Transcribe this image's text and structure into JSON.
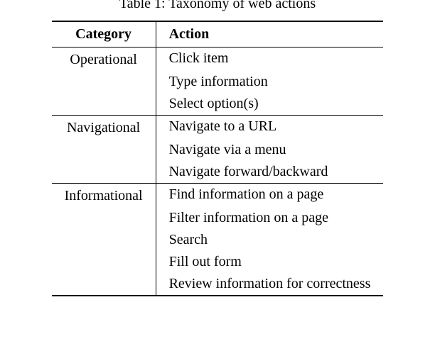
{
  "caption": "Table 1: Taxonomy of web actions",
  "headers": {
    "category": "Category",
    "action": "Action"
  },
  "rows": [
    {
      "category": "Operational",
      "action": "Click item"
    },
    {
      "category": "",
      "action": "Type information"
    },
    {
      "category": "",
      "action": "Select option(s)"
    },
    {
      "category": "Navigational",
      "action": "Navigate to a URL"
    },
    {
      "category": "",
      "action": "Navigate via a menu"
    },
    {
      "category": "",
      "action": "Navigate forward/backward"
    },
    {
      "category": "Informational",
      "action": "Find information on a page"
    },
    {
      "category": "",
      "action": "Filter information on a page"
    },
    {
      "category": "",
      "action": "Search"
    },
    {
      "category": "",
      "action": "Fill out form"
    },
    {
      "category": "",
      "action": "Review information for correctness"
    }
  ],
  "chart_data": {
    "type": "table",
    "title": "Table 1: Taxonomy of web actions",
    "columns": [
      "Category",
      "Action"
    ],
    "groups": [
      {
        "category": "Operational",
        "actions": [
          "Click item",
          "Type information",
          "Select option(s)"
        ]
      },
      {
        "category": "Navigational",
        "actions": [
          "Navigate to a URL",
          "Navigate via a menu",
          "Navigate forward/backward"
        ]
      },
      {
        "category": "Informational",
        "actions": [
          "Find information on a page",
          "Filter information on a page",
          "Search",
          "Fill out form",
          "Review information for correctness"
        ]
      }
    ]
  }
}
